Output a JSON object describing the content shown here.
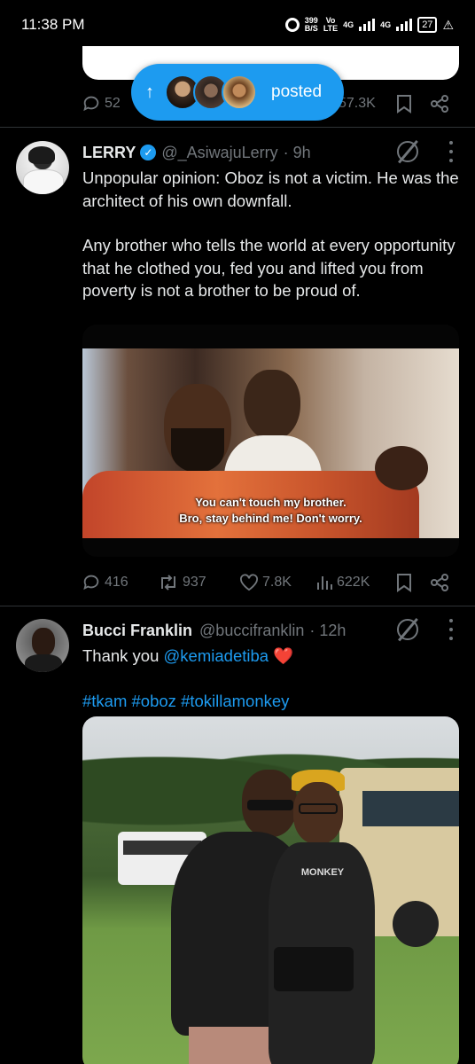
{
  "status_bar": {
    "time": "11:38 PM",
    "net_speed": "399",
    "net_unit": "B/S",
    "volte_top": "Vo",
    "volte_bottom": "LTE",
    "net1": "4G",
    "net2": "4G",
    "battery": "27"
  },
  "previous_tweet": {
    "replies": "52",
    "views": "57.3K"
  },
  "posted_pill": {
    "label": "posted"
  },
  "tweets": [
    {
      "name": "LERRY",
      "handle": "@_AsiwajuLerry",
      "time": "· 9h",
      "text_1": "Unpopular opinion: Oboz is not a victim. He was the architect of his own downfall.",
      "text_2": "Any brother who tells the world at every opportunity that he clothed you, fed you and lifted you from poverty is not a brother to be proud of.",
      "subtitle_1": "You can't touch my brother.",
      "subtitle_2": "Bro, stay behind me! Don't worry.",
      "replies": "416",
      "reposts": "937",
      "likes": "7.8K",
      "views": "622K"
    },
    {
      "name": "Bucci Franklin",
      "handle": "@buccifranklin",
      "time": "· 12h",
      "text_prefix": "Thank you ",
      "mention": "@kemiadetiba",
      "emoji": "❤️",
      "hashtags": "#tkam #oboz #tokillamonkey",
      "shirt_text": "MONKEY"
    }
  ],
  "colors": {
    "background": "#000000",
    "accent": "#1d9bf0",
    "muted": "#71767b",
    "text": "#e7e9ea"
  }
}
